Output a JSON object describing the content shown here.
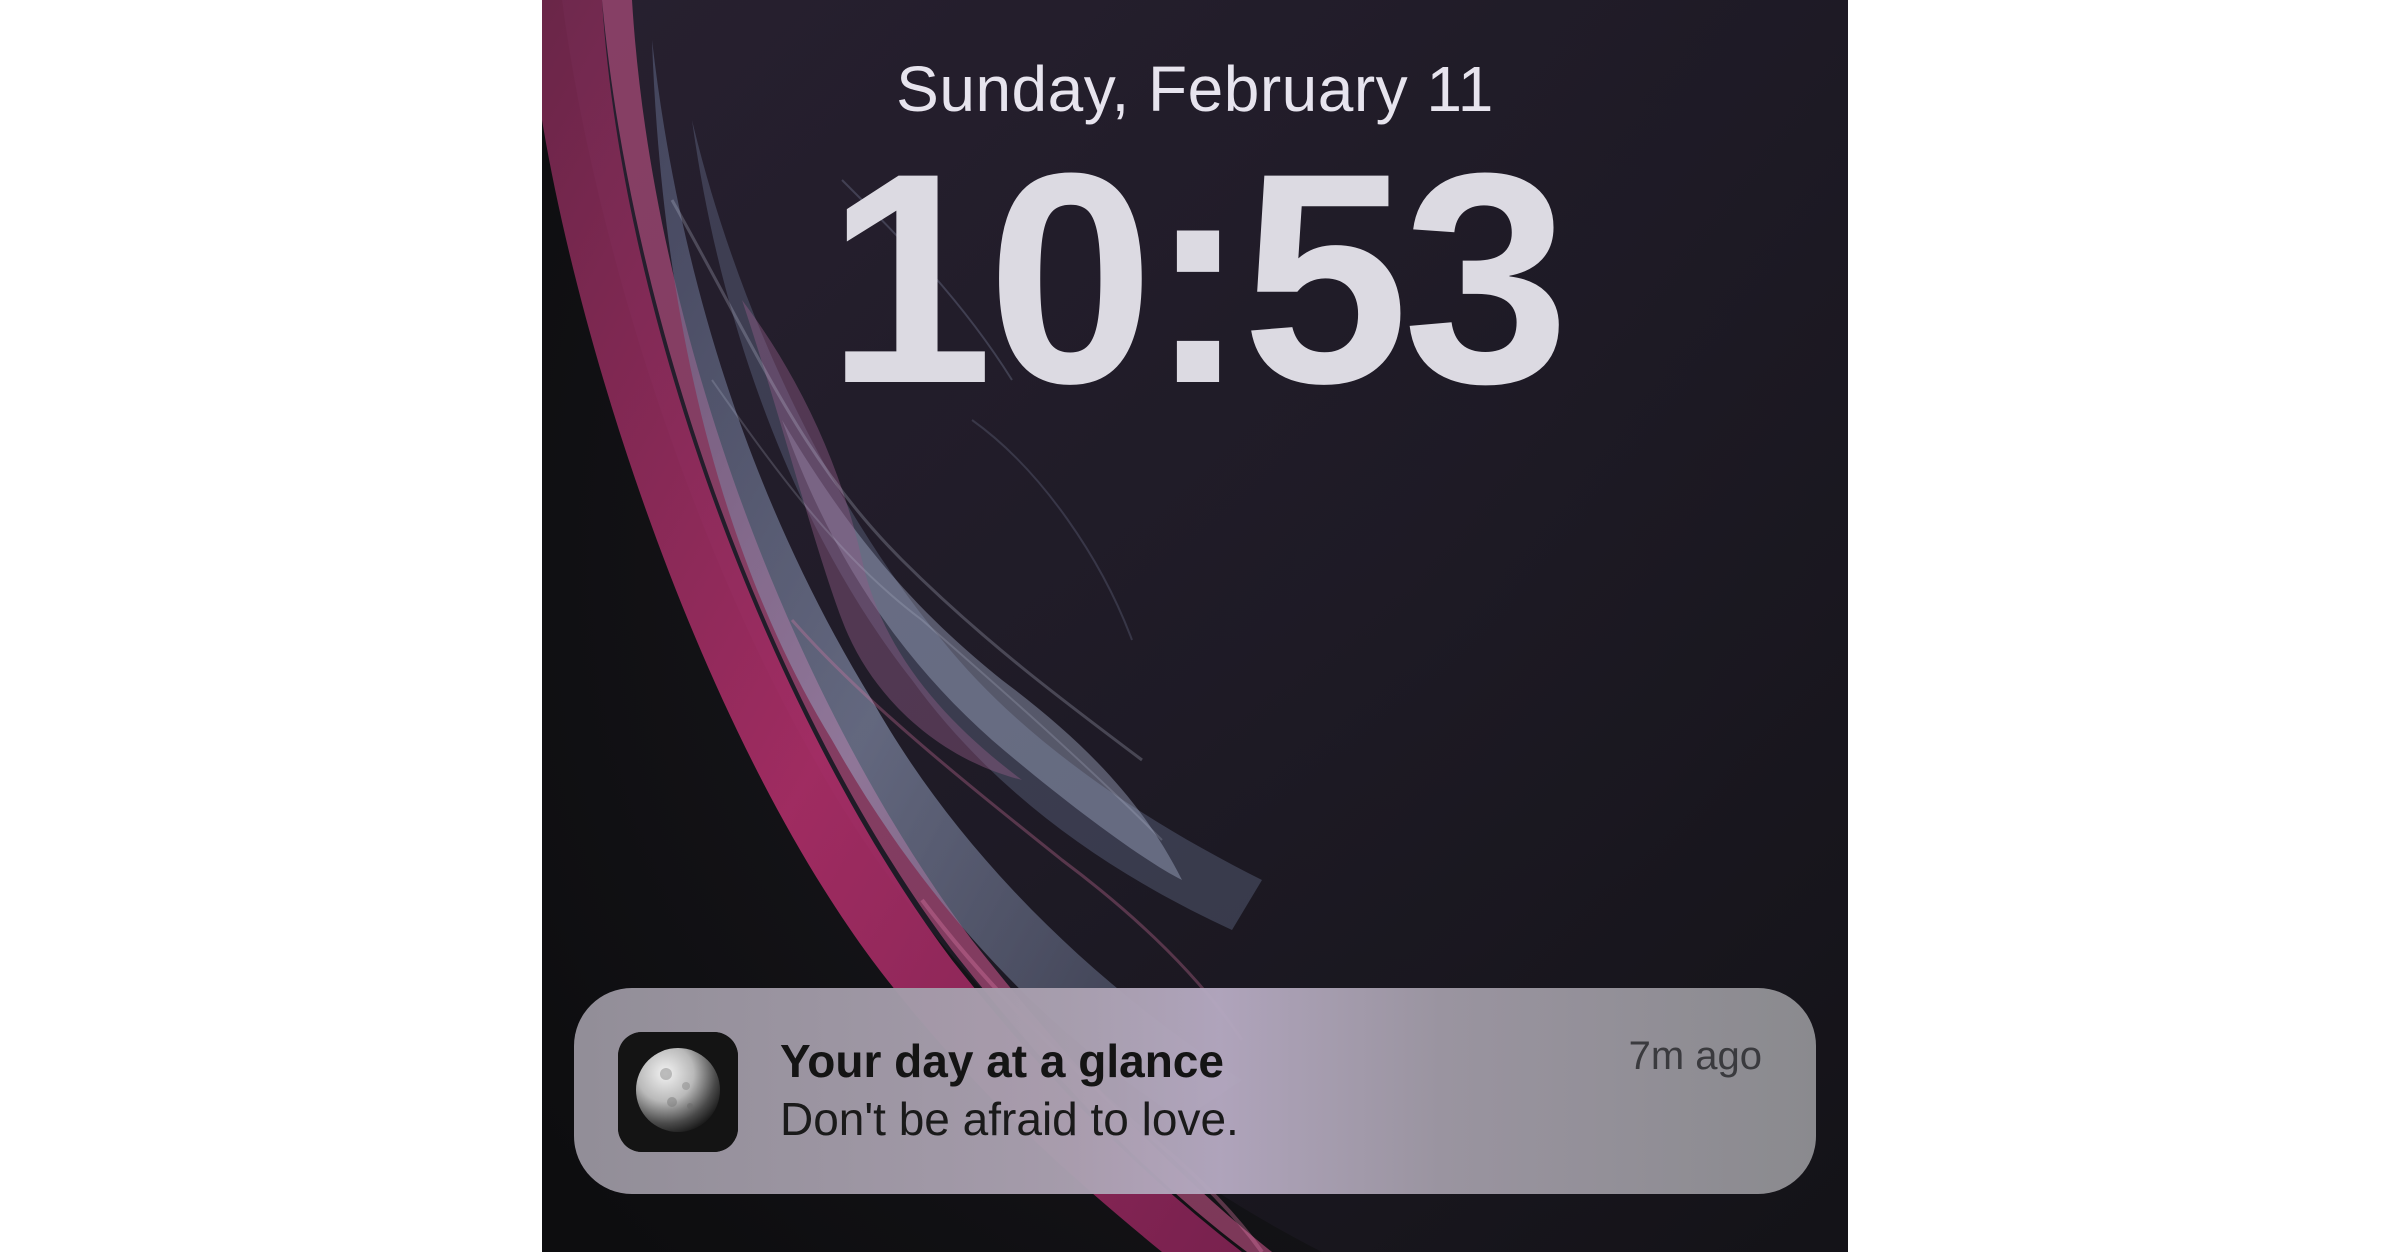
{
  "lock_screen": {
    "date": "Sunday, February 11",
    "time": "10:53"
  },
  "notification": {
    "app_icon": "moon-icon",
    "title": "Your day at a glance",
    "body": "Don't be afraid to love.",
    "timestamp": "7m ago"
  },
  "colors": {
    "page_background": "#ffffff",
    "wallpaper_base": "#111113",
    "wallpaper_accent_magenta": "#b8306e",
    "wallpaper_accent_blue": "#7f90b8",
    "clock_text": "#dcdae2"
  }
}
